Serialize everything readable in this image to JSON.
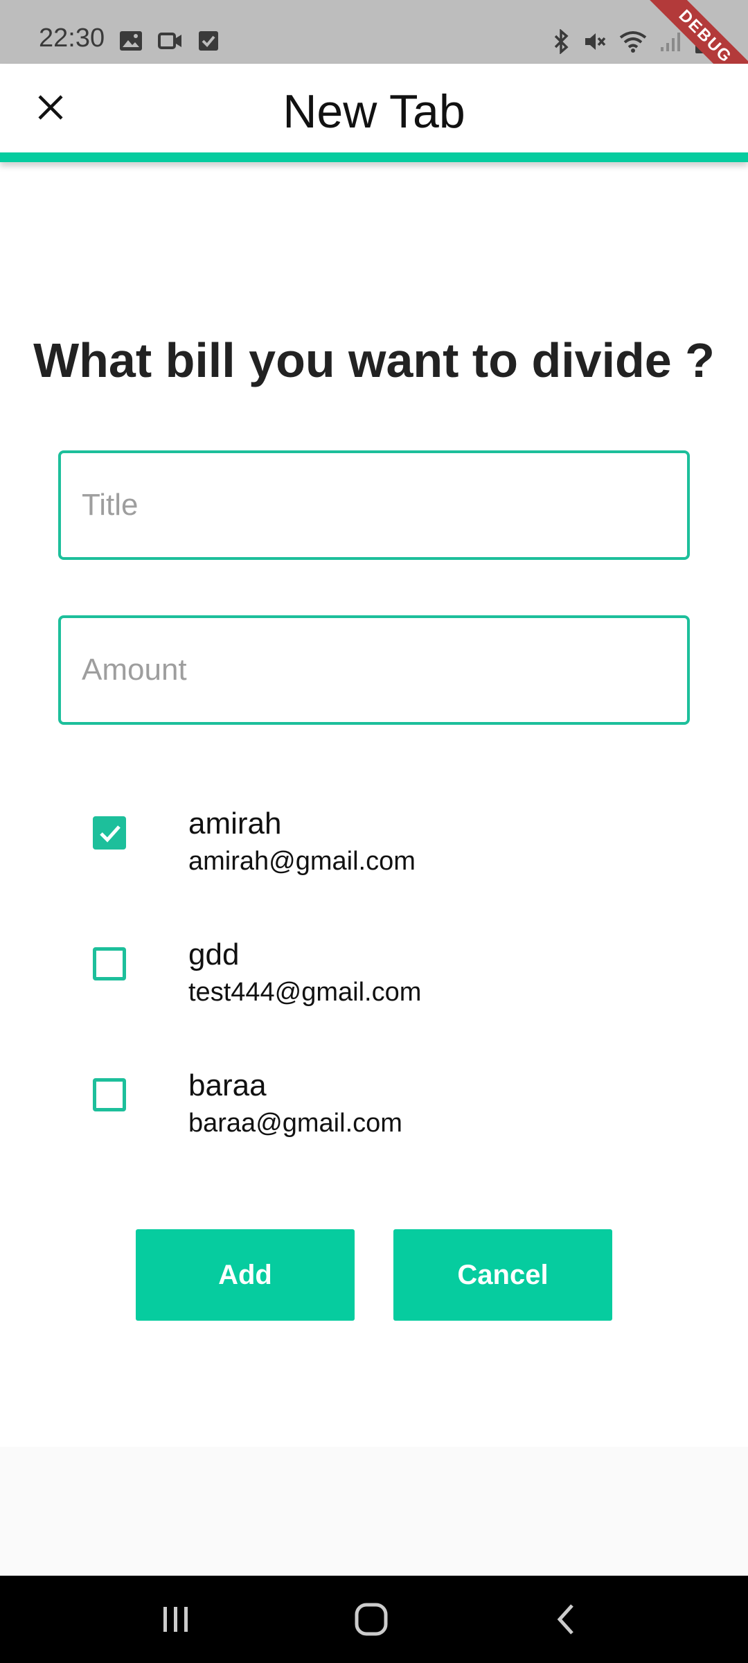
{
  "status_bar": {
    "time": "22:30",
    "debug_label": "DEBUG"
  },
  "app_bar": {
    "title": "New Tab",
    "close_icon": "close-icon"
  },
  "form": {
    "question": "What bill you want to divide ?",
    "title_placeholder": "Title",
    "title_value": "",
    "amount_placeholder": "Amount",
    "amount_value": ""
  },
  "members": [
    {
      "name": "amirah",
      "email": "amirah@gmail.com",
      "checked": true
    },
    {
      "name": "gdd",
      "email": "test444@gmail.com",
      "checked": false
    },
    {
      "name": "baraa",
      "email": "baraa@gmail.com",
      "checked": false
    }
  ],
  "actions": {
    "add_label": "Add",
    "cancel_label": "Cancel"
  },
  "colors": {
    "accent": "#06cc9f",
    "border": "#1dbf9b",
    "status_bar": "#bdbdbd"
  }
}
